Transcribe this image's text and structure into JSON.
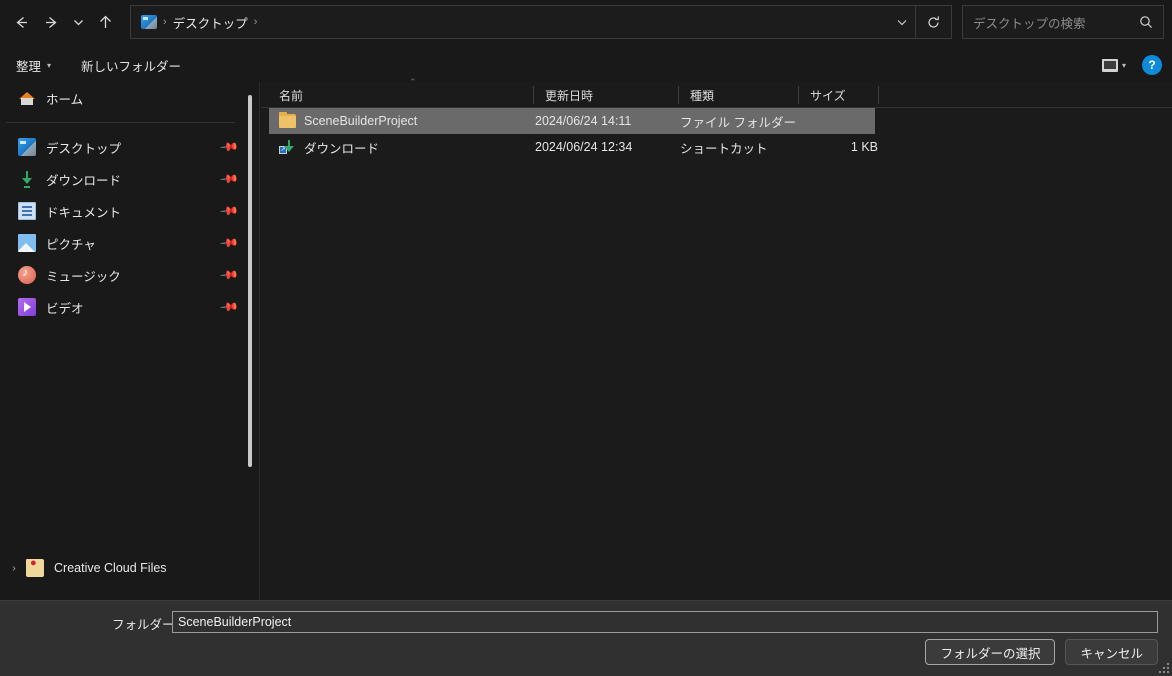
{
  "nav": {
    "back_icon": "arrow-left-icon",
    "forward_icon": "arrow-right-icon",
    "recent_icon": "chevron-down-icon",
    "up_icon": "arrow-up-icon",
    "breadcrumb": [
      {
        "label": "デスクトップ",
        "icon": "desktop-icon"
      }
    ],
    "separator": "›",
    "dropdown_icon": "chevron-down-icon",
    "refresh_icon": "refresh-icon"
  },
  "search": {
    "placeholder": "デスクトップの検索",
    "icon": "search-icon"
  },
  "toolbar": {
    "organize_label": "整理",
    "organize_caret": "▾",
    "new_folder_label": "新しいフォルダー",
    "view_icon": "list-view-icon",
    "view_caret": "▾",
    "help_label": "?"
  },
  "sidebar": {
    "home": {
      "label": "ホーム",
      "icon": "home-icon"
    },
    "items": [
      {
        "label": "デスクトップ",
        "icon": "desktop-icon",
        "pinned": true
      },
      {
        "label": "ダウンロード",
        "icon": "download-icon",
        "pinned": true
      },
      {
        "label": "ドキュメント",
        "icon": "documents-icon",
        "pinned": true
      },
      {
        "label": "ピクチャ",
        "icon": "pictures-icon",
        "pinned": true
      },
      {
        "label": "ミュージック",
        "icon": "music-icon",
        "pinned": true
      },
      {
        "label": "ビデオ",
        "icon": "video-icon",
        "pinned": true
      }
    ],
    "pin_glyph": "📌",
    "bottom": {
      "label": "Creative Cloud Files",
      "icon": "creative-cloud-folder-icon",
      "expander": "›"
    }
  },
  "filelist": {
    "columns": [
      {
        "key": "name",
        "label": "名前"
      },
      {
        "key": "date",
        "label": "更新日時"
      },
      {
        "key": "type",
        "label": "種類"
      },
      {
        "key": "size",
        "label": "サイズ"
      }
    ],
    "sort_indicator": "⌃",
    "rows": [
      {
        "name": "SceneBuilderProject",
        "date": "2024/06/24 14:11",
        "type": "ファイル フォルダー",
        "size": "",
        "icon": "folder-icon",
        "selected": true
      },
      {
        "name": "ダウンロード",
        "date": "2024/06/24 12:34",
        "type": "ショートカット",
        "size": "1 KB",
        "icon": "shortcut-icon",
        "selected": false
      }
    ]
  },
  "bottom": {
    "folder_label": "フォルダー:",
    "folder_value": "SceneBuilderProject",
    "select_button": "フォルダーの選択",
    "cancel_button": "キャンセル"
  },
  "colors": {
    "background": "#191919",
    "panel": "#1b1b1b",
    "bottom_bar": "#303030",
    "selection": "#6a6a6a",
    "accent": "#0d8bd9",
    "folder_yellow": "#e9b04a"
  }
}
